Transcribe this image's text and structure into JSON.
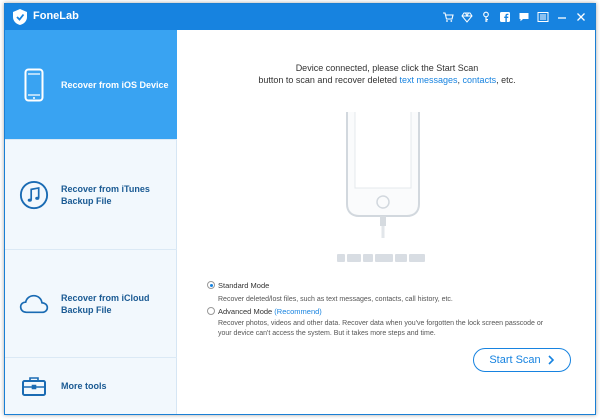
{
  "window": {
    "title": "FoneLab"
  },
  "titlebar_icons": [
    "cart-icon",
    "diamond-icon",
    "key-icon",
    "facebook-icon",
    "chat-icon",
    "menu-icon",
    "minimize-icon",
    "close-icon"
  ],
  "sidebar": {
    "items": [
      {
        "label": "Recover from iOS Device",
        "icon": "phone-icon",
        "active": true
      },
      {
        "label": "Recover from iTunes Backup File",
        "icon": "music-note-icon",
        "active": false
      },
      {
        "label": "Recover from iCloud Backup File",
        "icon": "cloud-icon",
        "active": false
      },
      {
        "label": "More tools",
        "icon": "toolbox-icon",
        "active": false
      }
    ]
  },
  "main": {
    "instruction_line1": "Device connected, please click the Start Scan",
    "instruction_line2_prefix": "button to scan and recover deleted ",
    "instruction_link1": "text messages",
    "instruction_sep": ", ",
    "instruction_link2": "contacts",
    "instruction_suffix": ", etc.",
    "standard_mode": {
      "label": "Standard Mode",
      "selected": true,
      "description": "Recover deleted/lost files, such as text messages, contacts, call history, etc."
    },
    "advanced_mode": {
      "label": "Advanced Mode",
      "tag": "(Recommend)",
      "selected": false,
      "description_line1": "Recover photos, videos and other data. Recover data when you've forgotten the lock screen passcode or",
      "description_line2": "your device can't access the system. But it takes more steps and time."
    },
    "start_button": "Start Scan"
  },
  "colors": {
    "accent": "#1783e0",
    "active_item": "#39a3f2"
  }
}
